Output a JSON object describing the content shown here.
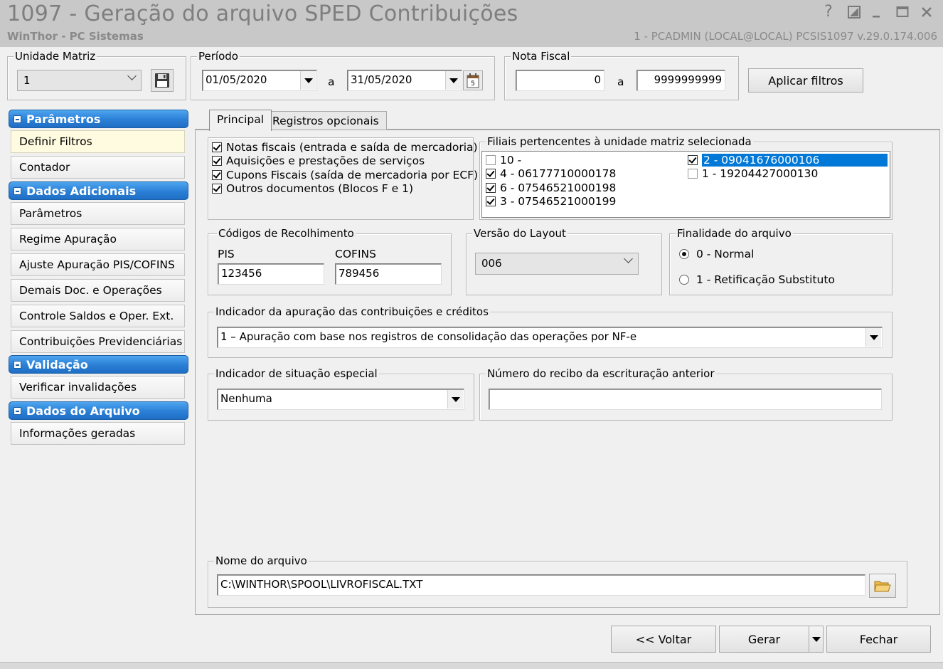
{
  "window": {
    "title": "1097 - Geração do arquivo SPED Contribuições",
    "subtitle": "WinThor - PC Sistemas",
    "userinfo": "1 - PCADMIN (LOCAL@LOCAL)   PCSIS1097  v.29.0.174.006",
    "help_glyph": "?"
  },
  "unidade_matriz": {
    "legend": "Unidade Matriz",
    "value": "1"
  },
  "periodo": {
    "legend": "Período",
    "from": "01/05/2020",
    "sep": "a",
    "to": "31/05/2020"
  },
  "nota_fiscal": {
    "legend": "Nota Fiscal",
    "from": "0",
    "sep": "a",
    "to": "9999999999"
  },
  "aplicar_filtros": "Aplicar filtros",
  "sidebar": {
    "sections": [
      {
        "header": "Parâmetros",
        "items": [
          "Definir Filtros",
          "Contador"
        ]
      },
      {
        "header": "Dados Adicionais",
        "items": [
          "Parâmetros",
          "Regime Apuração",
          "Ajuste Apuração PIS/COFINS",
          "Demais Doc. e Operações",
          "Controle Saldos e Oper. Ext.",
          "Contribuições Previdenciárias"
        ]
      },
      {
        "header": "Validação",
        "items": [
          "Verificar invalidações"
        ]
      },
      {
        "header": "Dados do Arquivo",
        "items": [
          "Informações geradas"
        ]
      }
    ]
  },
  "tabs": {
    "principal": "Principal",
    "opcionais": "Registros opcionais"
  },
  "documentos": [
    {
      "label": "Notas fiscais (entrada e saída de mercadoria)",
      "checked": true
    },
    {
      "label": "Aquisições e prestações de serviços",
      "checked": true
    },
    {
      "label": "Cupons Fiscais (saída de mercadoria por ECF)",
      "checked": true
    },
    {
      "label": "Outros documentos (Blocos F e 1)",
      "checked": true
    }
  ],
  "filiais": {
    "legend": "Filiais pertencentes à unidade matriz selecionada",
    "col1": [
      {
        "label": "10 -",
        "checked": false
      },
      {
        "label": "4 - 06177710000178",
        "checked": true
      },
      {
        "label": "6 - 07546521000198",
        "checked": true
      },
      {
        "label": "3 - 07546521000199",
        "checked": true
      }
    ],
    "col2": [
      {
        "label": "2 - 09041676000106",
        "checked": true,
        "selected": true
      },
      {
        "label": "1 - 19204427000130",
        "checked": false
      }
    ]
  },
  "codigos": {
    "legend": "Códigos de Recolhimento",
    "pis_label": "PIS",
    "pis": "123456",
    "cofins_label": "COFINS",
    "cofins": "789456"
  },
  "versao": {
    "legend": "Versão do Layout",
    "value": "006"
  },
  "finalidade": {
    "legend": "Finalidade do arquivo",
    "opt0": "0 - Normal",
    "opt1": "1 - Retificação Substituto",
    "selected": 0
  },
  "indicador_apuracao": {
    "legend": "Indicador da apuração das contribuições e créditos",
    "value": "1 – Apuração com base nos registros de consolidação das operações por NF-e"
  },
  "situacao": {
    "legend": "Indicador de situação especial",
    "value": "Nenhuma"
  },
  "recibo": {
    "legend": "Número do recibo da escrituração anterior",
    "value": ""
  },
  "arquivo": {
    "legend": "Nome do arquivo",
    "value": "C:\\WINTHOR\\SPOOL\\LIVROFISCAL.TXT"
  },
  "buttons": {
    "voltar": "<< Voltar",
    "gerar": "Gerar",
    "fechar": "Fechar"
  }
}
